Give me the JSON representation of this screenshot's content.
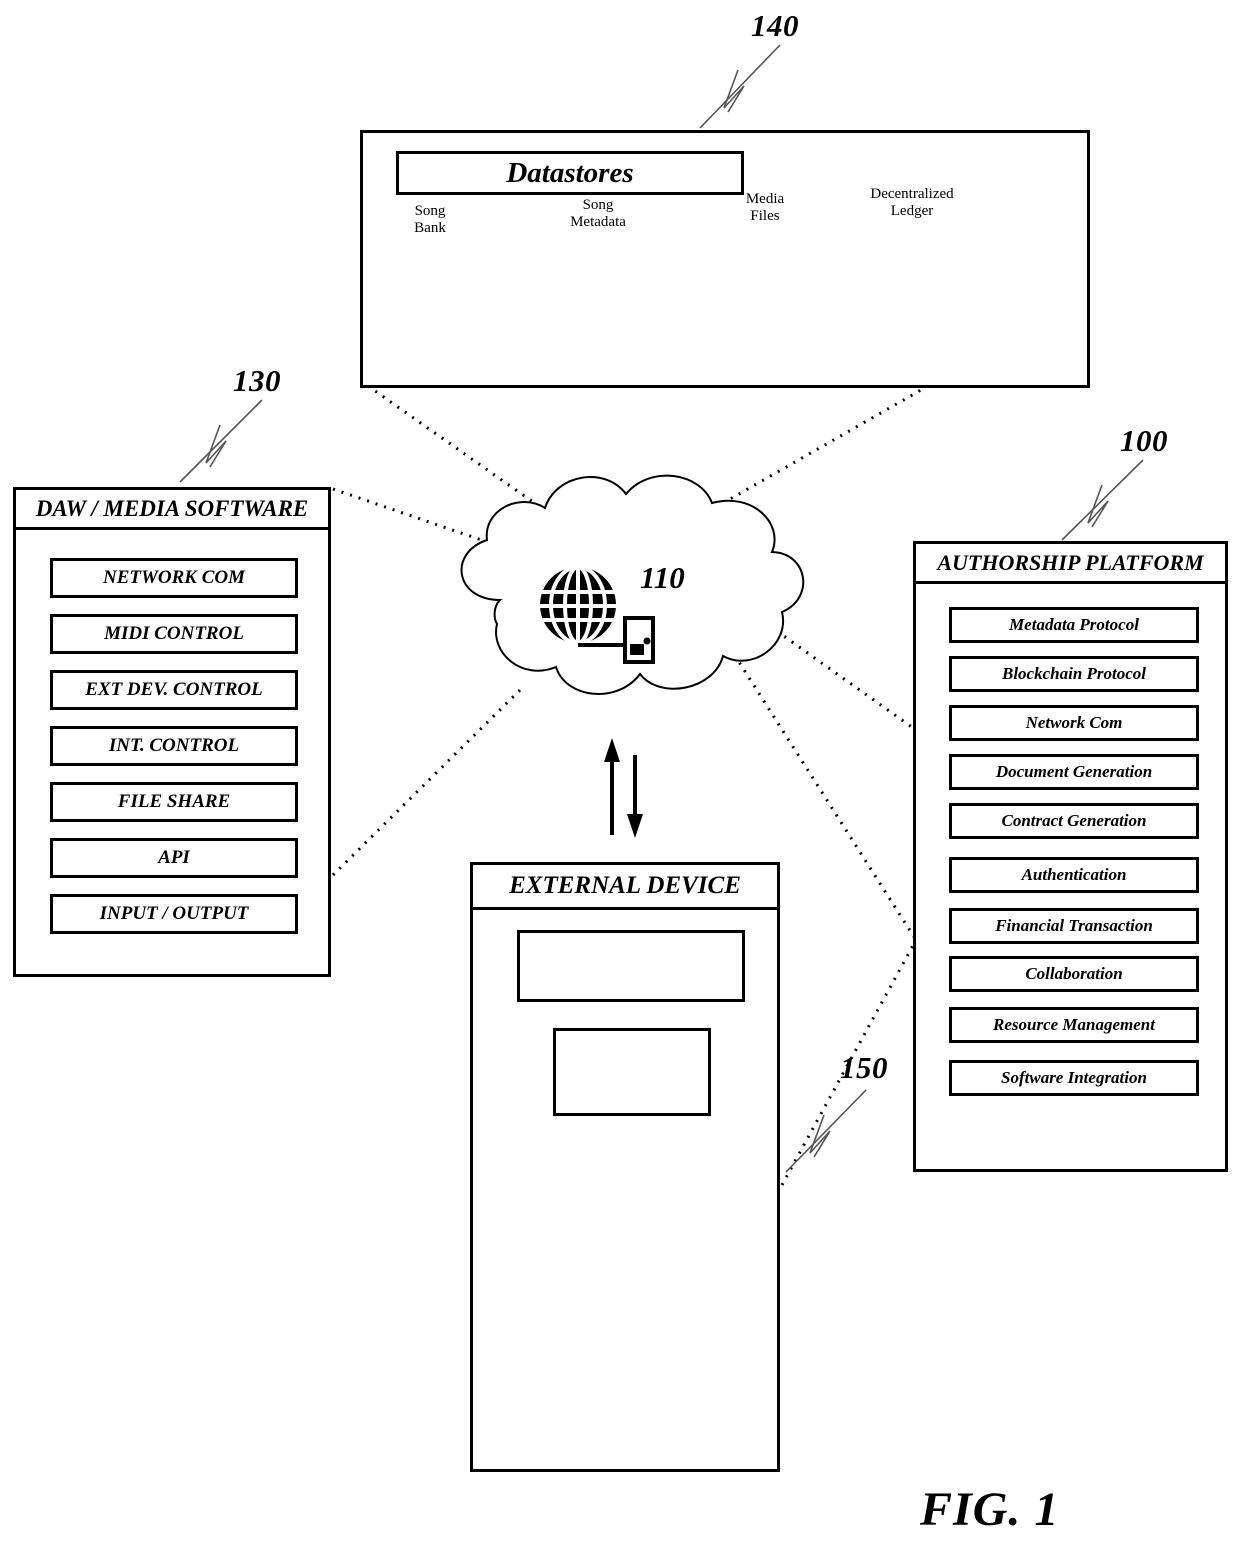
{
  "figure": {
    "caption": "FIG. 1"
  },
  "datastores": {
    "ref": "140",
    "heading": "Datastores",
    "items": [
      {
        "label_line1": "Song",
        "label_line2": "Bank",
        "icon": "database-cylinder-icon"
      },
      {
        "label_line1": "Song",
        "label_line2": "Metadata",
        "icon": "database-cylinder-icon"
      },
      {
        "label_line1": "Media",
        "label_line2": "Files",
        "icon": "database-cylinder-icon"
      },
      {
        "label_line1": "Decentralized",
        "label_line2": "Ledger",
        "icon": "database-cylinder-icon"
      }
    ]
  },
  "daw": {
    "ref": "130",
    "title": "DAW / MEDIA SOFTWARE",
    "items": [
      {
        "label": "NETWORK COM"
      },
      {
        "label": "MIDI CONTROL"
      },
      {
        "label": "EXT DEV. CONTROL"
      },
      {
        "label": "INT. CONTROL"
      },
      {
        "label": "FILE SHARE"
      },
      {
        "label": "API"
      },
      {
        "label": "INPUT / OUTPUT"
      }
    ]
  },
  "authorship": {
    "ref": "100",
    "title": "AUTHORSHIP PLATFORM",
    "items": [
      {
        "label": "Metadata Protocol"
      },
      {
        "label": "Blockchain Protocol"
      },
      {
        "label": "Network Com"
      },
      {
        "label": "Document Generation"
      },
      {
        "label": "Contract Generation"
      },
      {
        "label": "Authentication"
      },
      {
        "label": "Financial Transaction"
      },
      {
        "label": "Collaboration"
      },
      {
        "label": "Resource Management"
      },
      {
        "label": "Software Integration"
      }
    ]
  },
  "external_device": {
    "ref": "150",
    "title": "EXTERNAL DEVICE",
    "device_icons": [
      "desktop-computer-icon",
      "laptop-icon",
      "tablet-small-icon",
      "phone-small-icon",
      "video-camera-icon",
      "tablet-icon",
      "smartphone-icon"
    ]
  },
  "network": {
    "ref": "110",
    "icon": "globe-icon",
    "secondary_icon": "server-node-icon",
    "shape": "cloud"
  },
  "colors": {
    "stroke": "#000000",
    "background": "#ffffff"
  }
}
